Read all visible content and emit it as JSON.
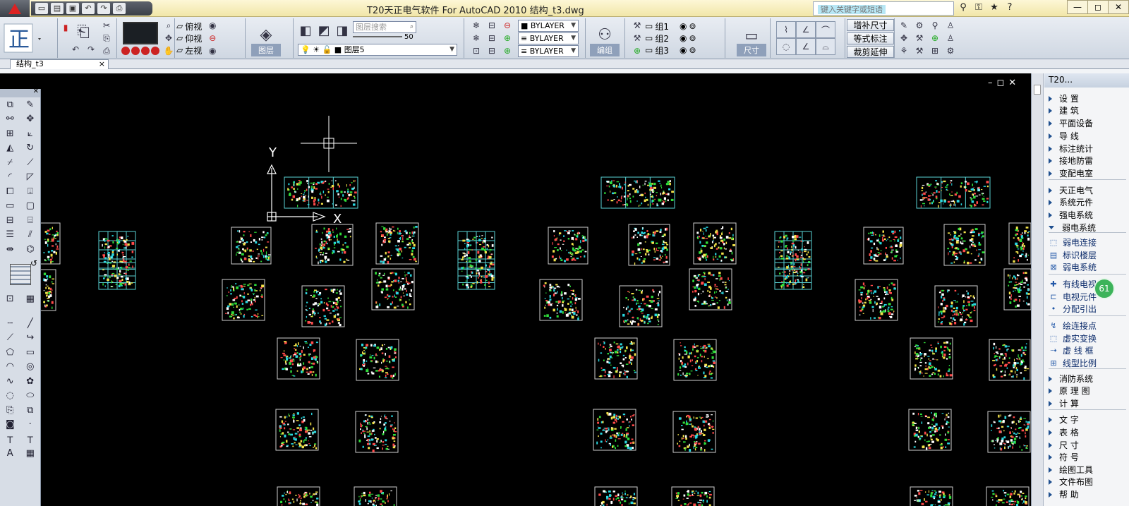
{
  "window": {
    "title": "T20天正电气软件 For AutoCAD 2010      结构_t3.dwg",
    "search_placeholder": "键入关键字或短语",
    "controls": [
      "—",
      "◻",
      "✕"
    ]
  },
  "qat": {
    "icons": [
      "new-icon",
      "open-icon",
      "save-icon",
      "undo-icon",
      "redo-icon",
      "print-icon"
    ]
  },
  "ribbon": {
    "views": [
      "俯视",
      "仰视",
      "左视"
    ],
    "layer_search_placeholder": "图层搜索",
    "layer_slider_value": "50",
    "layer_current": "图层5",
    "layer_panel_label": "图层",
    "bylayer": [
      "BYLAYER",
      "BYLAYER",
      "BYLAYER"
    ],
    "groups": [
      "组1",
      "组2",
      "组3"
    ],
    "group_panel_label": "编组",
    "dim_panel_label": "尺寸",
    "dim_buttons": [
      "增补尺寸",
      "等式标注",
      "裁剪延伸"
    ]
  },
  "doc_tab": {
    "name": "结构_t3",
    "close": "×"
  },
  "canvas": {
    "ucs_y": "Y",
    "ucs_x": "X",
    "ctrls": [
      "–",
      "◻",
      "✕"
    ]
  },
  "right_panel": {
    "title": "T20...",
    "badge": "61",
    "items": [
      {
        "label": "设    置",
        "type": "arr"
      },
      {
        "label": "建    筑",
        "type": "arr"
      },
      {
        "label": "平面设备",
        "type": "arr"
      },
      {
        "label": "导    线",
        "type": "arr"
      },
      {
        "label": "标注统计",
        "type": "arr"
      },
      {
        "label": "接地防雷",
        "type": "arr"
      },
      {
        "label": "变配电室",
        "type": "arr"
      },
      {
        "label": "天正电气",
        "type": "arr"
      },
      {
        "label": "系统元件",
        "type": "arr"
      },
      {
        "label": "强电系统",
        "type": "arr"
      },
      {
        "label": "弱电系统",
        "type": "down"
      },
      {
        "label": "弱电连接",
        "type": "ico"
      },
      {
        "label": "标识楼层",
        "type": "ico"
      },
      {
        "label": "弱电系统",
        "type": "ico"
      },
      {
        "label": "有线电视",
        "type": "ico"
      },
      {
        "label": "电视元件",
        "type": "ico"
      },
      {
        "label": "分配引出",
        "type": "ico"
      },
      {
        "label": "绘连接点",
        "type": "ico"
      },
      {
        "label": "虚实变换",
        "type": "ico"
      },
      {
        "label": "虚 线 框",
        "type": "ico"
      },
      {
        "label": "线型比例",
        "type": "ico"
      },
      {
        "label": "消防系统",
        "type": "arr"
      },
      {
        "label": "原 理 图",
        "type": "arr"
      },
      {
        "label": "计    算",
        "type": "arr"
      },
      {
        "label": "文    字",
        "type": "arr"
      },
      {
        "label": "表    格",
        "type": "arr"
      },
      {
        "label": "尺    寸",
        "type": "arr"
      },
      {
        "label": "符    号",
        "type": "arr"
      },
      {
        "label": "绘图工具",
        "type": "arr"
      },
      {
        "label": "文件布图",
        "type": "arr"
      },
      {
        "label": "帮    助",
        "type": "arr"
      }
    ]
  }
}
